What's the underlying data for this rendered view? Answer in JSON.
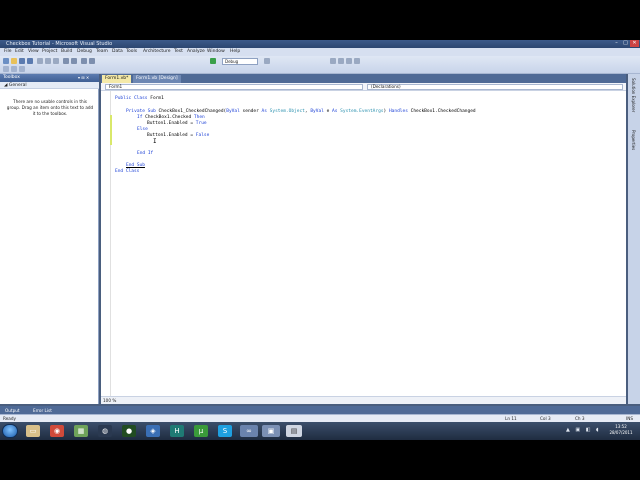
{
  "window": {
    "title": "Checkbox Tutorial - Microsoft Visual Studio",
    "controls": {
      "minimize": "–",
      "maximize": "□",
      "close": "✕"
    }
  },
  "menu": [
    "File",
    "Edit",
    "View",
    "Project",
    "Build",
    "Debug",
    "Team",
    "Data",
    "Tools",
    "Architecture",
    "Test",
    "Analyze",
    "Window",
    "Help"
  ],
  "toolbar": {
    "configuration": "Debug"
  },
  "toolbox": {
    "title": "Toolbox",
    "header_buttons": "▾ ⊞ ✕",
    "group": "General",
    "empty_message": "There are no usable controls in this group. Drag an item onto this text to add it to the toolbox."
  },
  "editor": {
    "tabs": [
      {
        "label": "Form1.vb*",
        "active": true
      },
      {
        "label": "Form1.vb [Design]",
        "active": false
      }
    ],
    "class_combo": "Form1",
    "member_combo": "(Declarations)",
    "zoom": "100 %"
  },
  "code": {
    "line1_kw": "Public Class",
    "line1_name": "Form1",
    "line2_kw1": "Private Sub",
    "line2_name": "CheckBox1_CheckedChanged(",
    "line2_kw2": "ByVal",
    "line2_p1": "sender",
    "line2_as1": "As",
    "line2_t1": "System.Object",
    "line2_kw3": "ByVal",
    "line2_p2": "e",
    "line2_as2": "As",
    "line2_t2": "System.EventArgs",
    "line2_kw4": "Handles",
    "line2_handles": "CheckBox1.CheckedChanged",
    "line3_kw1": "If",
    "line3_expr": "CheckBox1.Checked",
    "line3_kw2": "Then",
    "line4": "Button1.Enabled = True",
    "line4_kw": "True",
    "line5_kw": "Else",
    "line6": "Button1.Enabled = False",
    "line6_kw": "False",
    "line7_kw": "End If",
    "line8_kw": "End Sub",
    "line9_kw": "End Class"
  },
  "right_panels": [
    "Solution Explorer",
    "Properties"
  ],
  "bottom_tabs": [
    "Output",
    "Error List"
  ],
  "status": {
    "left": "Ready",
    "ln": "Ln 11",
    "col": "Col 3",
    "ch": "Ch 3",
    "mode": "INS"
  },
  "taskbar": {
    "tray": "▲ ▣ ◧ ◖",
    "time": "13:52",
    "date": "28/07/2011"
  },
  "colors": {
    "keyword": "#1a3fd6",
    "type": "#2b91af",
    "chrome": "#4f6a96",
    "changed_marker": "#d9e86a"
  }
}
